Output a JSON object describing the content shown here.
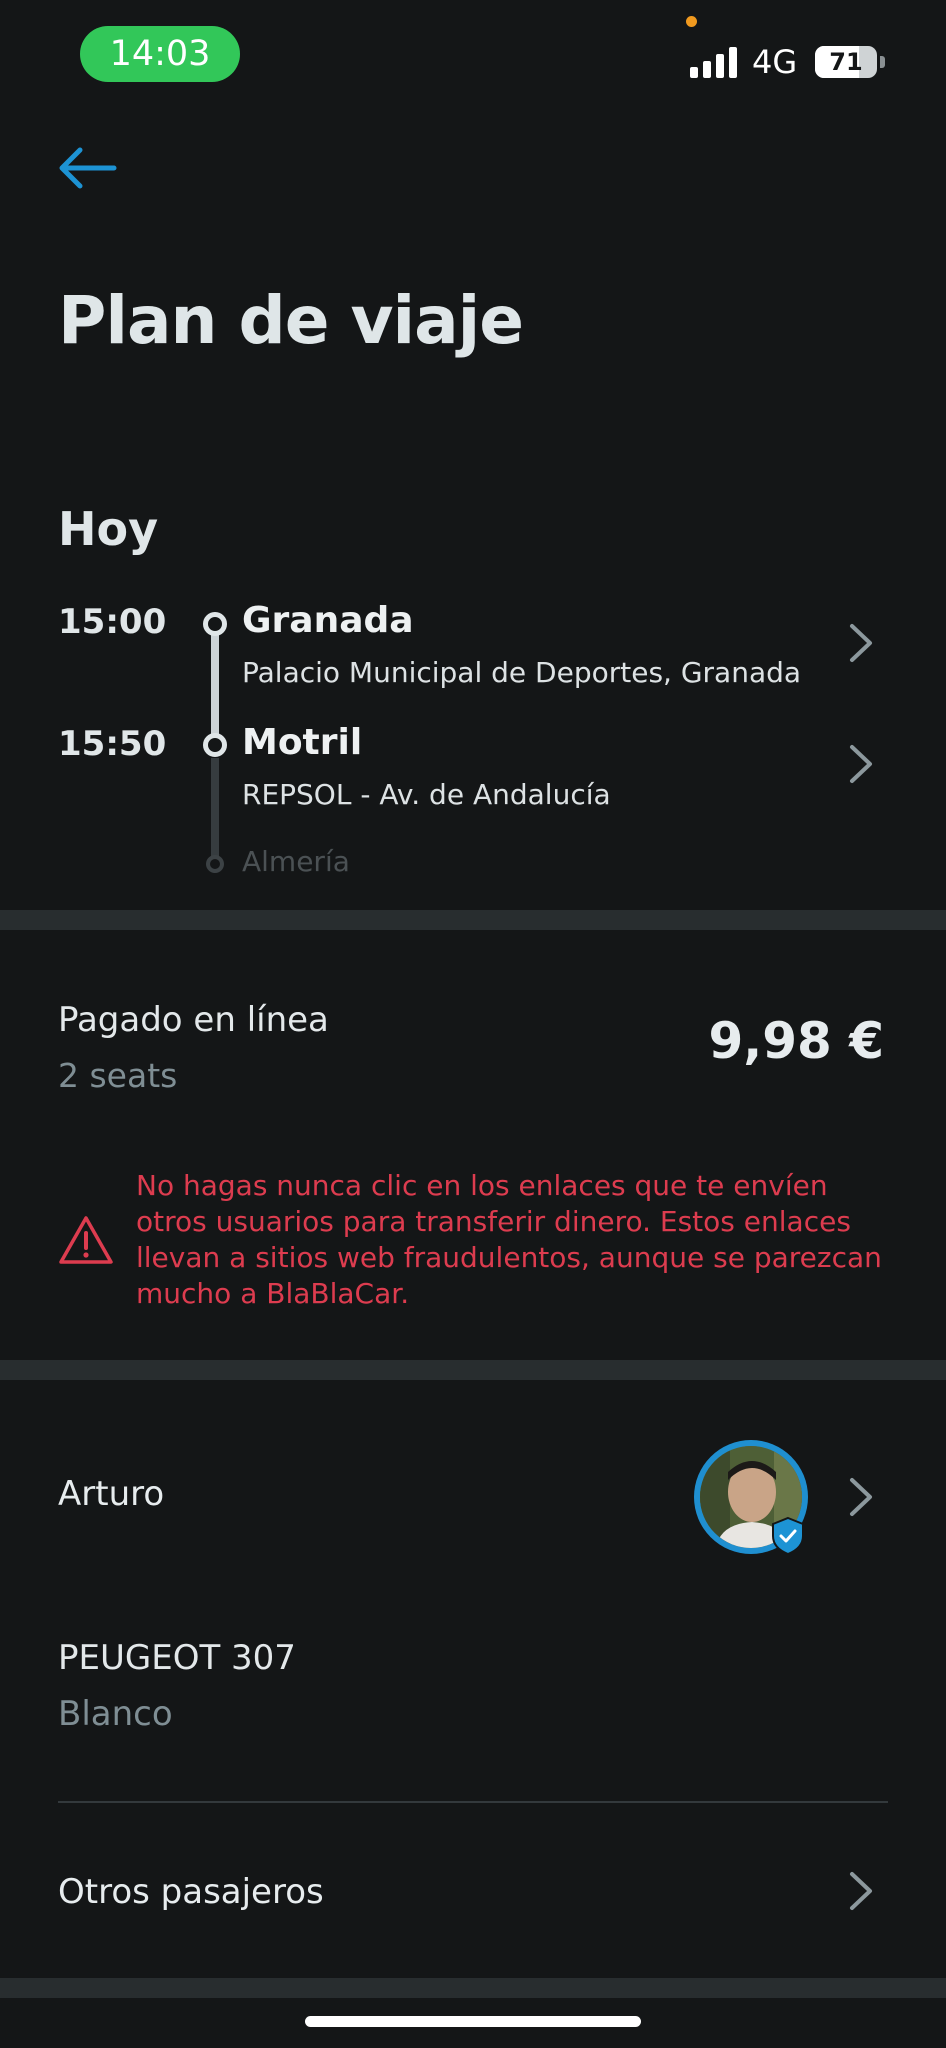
{
  "status_bar": {
    "time": "14:03",
    "network": "4G",
    "battery": "71",
    "battery_level": 0.71
  },
  "header": {
    "back_icon": "arrow-left-icon",
    "title": "Plan de viaje"
  },
  "itinerary": {
    "day": "Hoy",
    "stops": [
      {
        "time": "15:00",
        "city": "Granada",
        "address": "Palacio Municipal de Deportes, Granada"
      },
      {
        "time": "15:50",
        "city": "Motril",
        "address": "REPSOL - Av. de Andalucía"
      }
    ],
    "final_destination": "Almería"
  },
  "payment": {
    "label": "Pagado en línea",
    "seats": "2 seats",
    "price": "9,98 €"
  },
  "warning": {
    "icon": "warning-triangle-icon",
    "text": "No hagas nunca clic en los enlaces que te envíen otros usuarios para transferir dinero. Estos enlaces llevan a sitios web fraudulentos, aunque se parezcan mucho a BlaBlaCar."
  },
  "driver": {
    "name": "Arturo",
    "verified_icon": "verified-shield-icon"
  },
  "car": {
    "model": "PEUGEOT 307",
    "color": "Blanco"
  },
  "passengers": {
    "label": "Otros pasajeros"
  },
  "colors": {
    "background": "#141617",
    "accent": "#1f8fd0",
    "warning": "#dd3c4f",
    "status_green": "#32c759",
    "secondary_text": "#7f8e94"
  }
}
